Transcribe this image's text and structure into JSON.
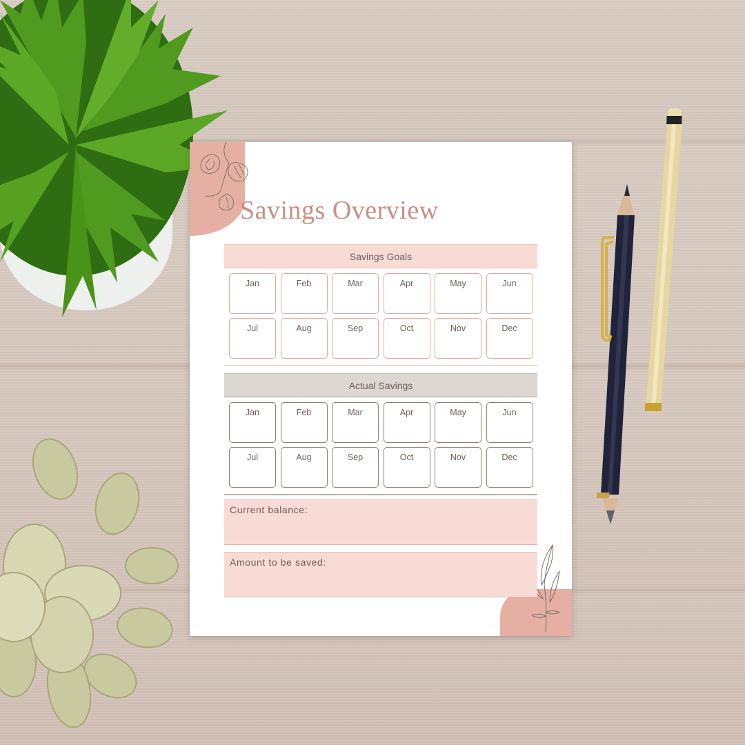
{
  "document": {
    "title": "Savings Overview",
    "savings_goals": {
      "heading": "Savings Goals",
      "months": [
        "Jan",
        "Feb",
        "Mar",
        "Apr",
        "May",
        "Jun",
        "Jul",
        "Aug",
        "Sep",
        "Oct",
        "Nov",
        "Dec"
      ]
    },
    "actual_savings": {
      "heading": "Actual Savings",
      "months": [
        "Jan",
        "Feb",
        "Mar",
        "Apr",
        "May",
        "Jun",
        "Jul",
        "Aug",
        "Sep",
        "Oct",
        "Nov",
        "Dec"
      ]
    },
    "fields": {
      "current_balance": "Current balance:",
      "amount_to_be_saved": "Amount to be saved:"
    }
  },
  "colors": {
    "accent_pink": "#e5afa3",
    "light_pink": "#f9dbd5",
    "title_rose": "#c98f84",
    "gray_band": "#dcd7d3",
    "text_brown": "#6f5d56"
  },
  "scene": {
    "objects": [
      "fern-plant-icon",
      "white-pot",
      "succulent-plant-icon",
      "black-pencil-icon",
      "cream-pen-icon",
      "wooden-table"
    ]
  }
}
